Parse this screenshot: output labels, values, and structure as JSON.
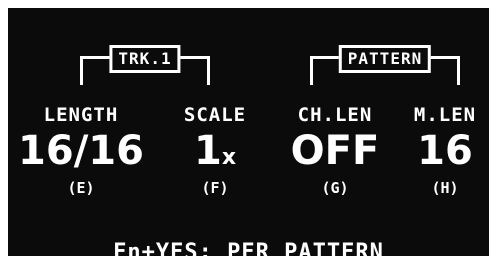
{
  "groups": {
    "track_tag": "TRK.1",
    "pattern_tag": "PATTERN"
  },
  "params": [
    {
      "label": "LENGTH",
      "value": "16/16",
      "unit": "",
      "key": "(E)"
    },
    {
      "label": "SCALE",
      "value": "1",
      "unit": "x",
      "key": "(F)"
    },
    {
      "label": "CH.LEN",
      "value": "OFF",
      "unit": "",
      "key": "(G)"
    },
    {
      "label": "M.LEN",
      "value": "16",
      "unit": "",
      "key": "(H)"
    }
  ],
  "footer": "Fn+YES: PER PATTERN"
}
